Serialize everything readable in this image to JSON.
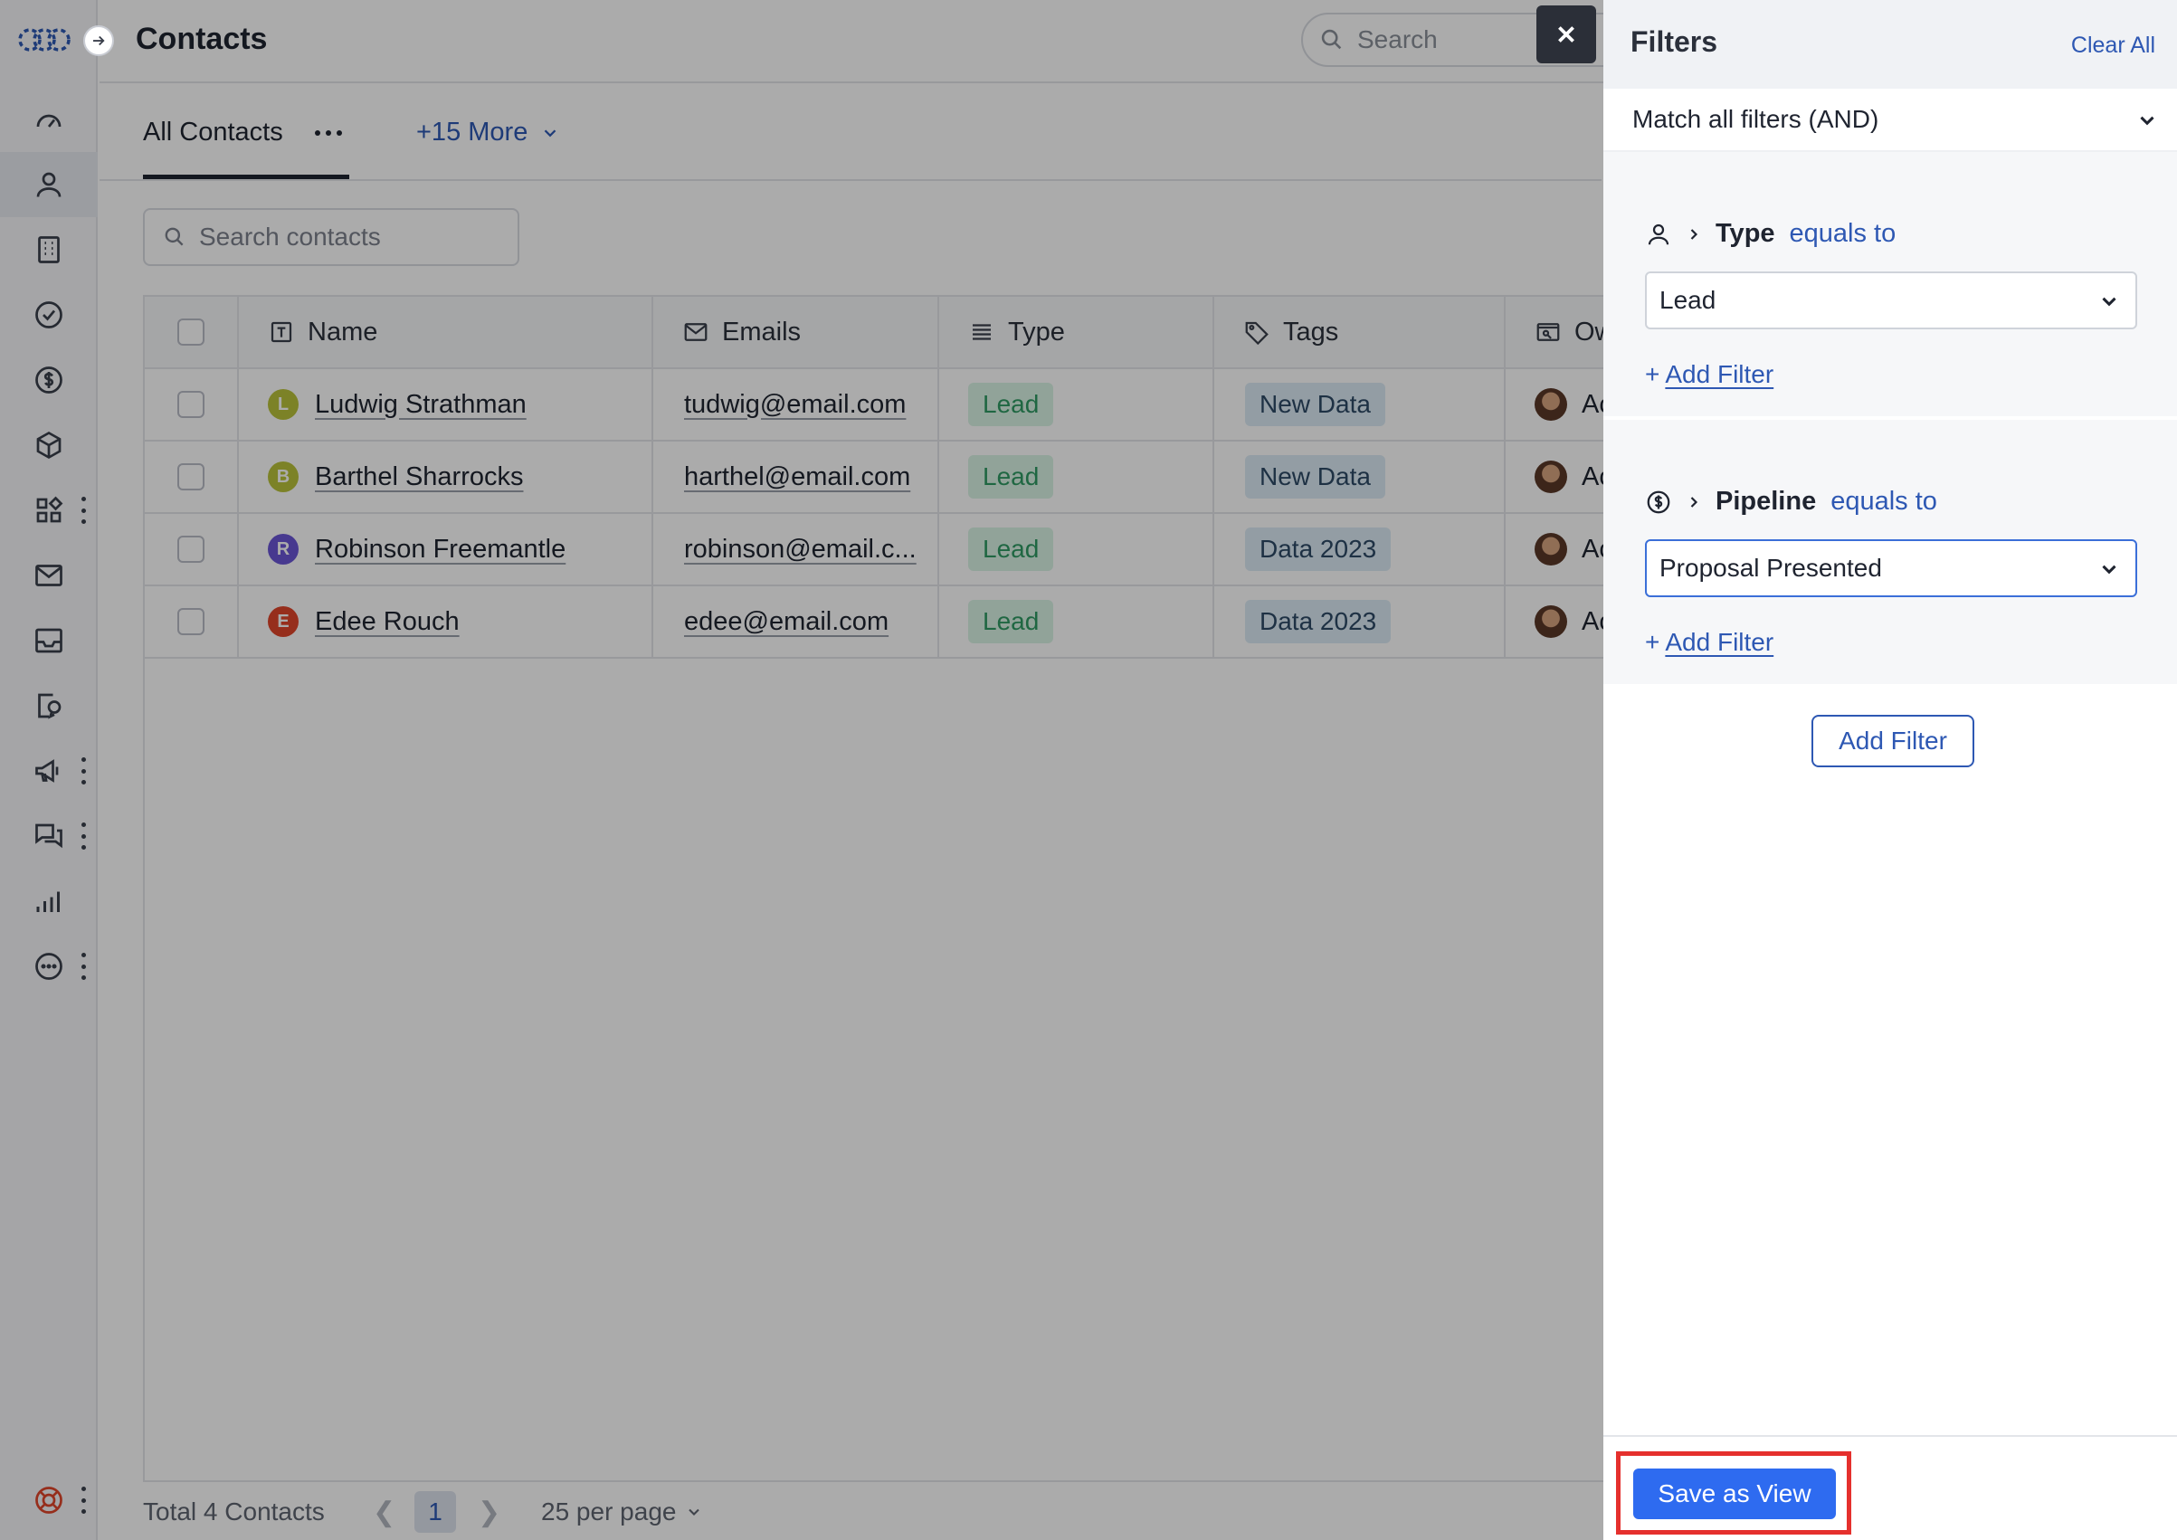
{
  "header": {
    "title": "Contacts",
    "search_placeholder": "Search"
  },
  "tabs": {
    "active": "All Contacts",
    "more": "+15 More"
  },
  "contacts_search": {
    "placeholder": "Search contacts"
  },
  "table": {
    "columns": [
      "Name",
      "Emails",
      "Type",
      "Tags",
      "Ow"
    ],
    "rows": [
      {
        "initial": "L",
        "avatar_color": "#b9c23b",
        "name": "Ludwig Strathman",
        "email": "tudwig@email.com",
        "type": "Lead",
        "tag": "New Data",
        "owner": "Ac"
      },
      {
        "initial": "B",
        "avatar_color": "#b9c23b",
        "name": "Barthel Sharrocks",
        "email": "harthel@email.com",
        "type": "Lead",
        "tag": "New Data",
        "owner": "Ac"
      },
      {
        "initial": "R",
        "avatar_color": "#6b55d6",
        "name": "Robinson Freemantle",
        "email": "robinson@email.c...",
        "type": "Lead",
        "tag": "Data 2023",
        "owner": "Ac"
      },
      {
        "initial": "E",
        "avatar_color": "#e0452b",
        "name": "Edee Rouch",
        "email": "edee@email.com",
        "type": "Lead",
        "tag": "Data 2023",
        "owner": "Ac"
      }
    ]
  },
  "footer": {
    "total": "Total 4 Contacts",
    "page": "1",
    "per_page": "25 per page"
  },
  "filters": {
    "title": "Filters",
    "clear_all": "Clear All",
    "match_mode": "Match all filters (AND)",
    "blocks": [
      {
        "icon": "person-icon",
        "field": "Type",
        "operator": "equals to",
        "value": "Lead",
        "add_label": "Add Filter"
      },
      {
        "icon": "dollar-circle-icon",
        "field": "Pipeline",
        "operator": "equals to",
        "value": "Proposal Presented",
        "add_label": "Add Filter"
      }
    ],
    "add_filter_button": "Add Filter",
    "save_view_button": "Save as View"
  },
  "colors": {
    "accent": "#2e58b3",
    "primary_button": "#2e6bf0",
    "highlight_box": "#e5302d"
  }
}
